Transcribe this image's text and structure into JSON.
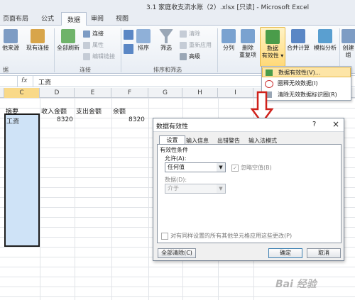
{
  "window": {
    "title": "3.1 家庭收支流水账（2）.xlsx [只读] - Microsoft Excel"
  },
  "tabs": [
    {
      "label": "页面布局"
    },
    {
      "label": "公式"
    },
    {
      "label": "数据"
    },
    {
      "label": "审阅"
    },
    {
      "label": "视图"
    }
  ],
  "ribbon": {
    "from_other": "他来源",
    "existing_conn": "现有连接",
    "refresh_all": "全部刷新",
    "connections": "连接",
    "properties": "属性",
    "edit_links": "编辑链接",
    "group_connections": "连接",
    "sort": "排序",
    "filter": "筛选",
    "clear": "清除",
    "reapply": "重新应用",
    "advanced": "高级",
    "group_sort_filter": "排序和筛选",
    "text_to_columns": "分列",
    "remove_dup_1": "删除",
    "remove_dup_2": "重复项",
    "data_validation_1": "数据",
    "data_validation_2": "有效性",
    "consolidate": "合并计算",
    "what_if": "模拟分析",
    "create_group": "创建组",
    "left_group_label": "据"
  },
  "formula_bar": {
    "fx": "fx",
    "value": "工资"
  },
  "columns": [
    "C",
    "D",
    "E",
    "F",
    "G",
    "H",
    "I"
  ],
  "cells": {
    "c1": "摘要",
    "d1": "收入金额",
    "e1": "支出金额",
    "f1": "余额",
    "c2": "工资",
    "d2": "8320",
    "f2": "8320"
  },
  "menu": {
    "items": [
      {
        "label": "数据有效性(V)..."
      },
      {
        "label": "圈释无效数据(I)"
      },
      {
        "label": "清除无效数据标识圈(R)"
      }
    ]
  },
  "dialog": {
    "title": "数据有效性",
    "help": "?",
    "close": "×",
    "tabs": [
      "设置",
      "输入信息",
      "出错警告",
      "输入法模式"
    ],
    "section": "有效性条件",
    "allow_label": "允许(A):",
    "allow_value": "任何值",
    "ignore_blank": "忽略空值(B)",
    "data_label": "数据(D):",
    "data_value": "介于",
    "apply_all": "对有同样设置的所有其他单元格应用这些更改(P)",
    "clear_all": "全部清除(C)",
    "ok": "确定",
    "cancel": "取消"
  },
  "watermark": "Bai 经验"
}
